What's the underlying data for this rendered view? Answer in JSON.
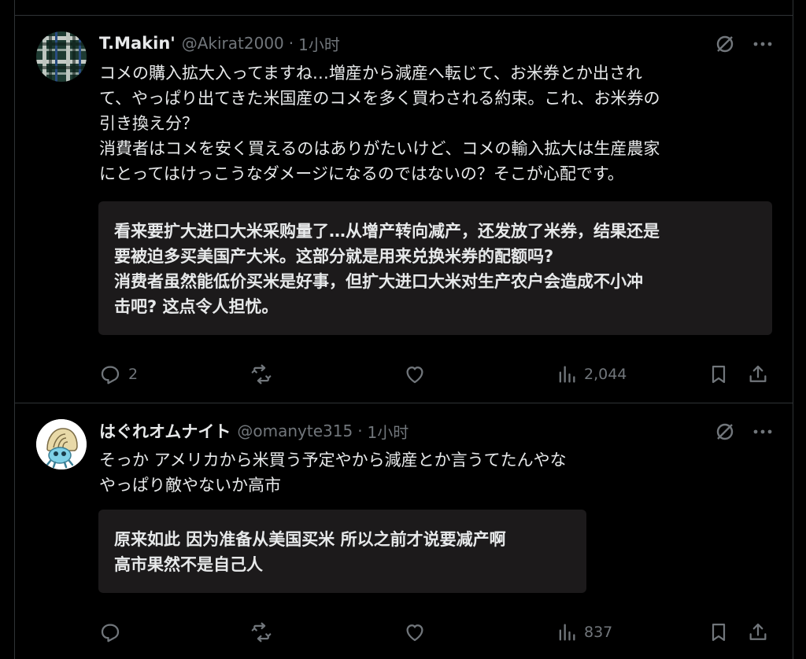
{
  "posts": [
    {
      "author_name": "T.Makin'",
      "handle": "@Akirat2000",
      "separator": "·",
      "time": "1小时",
      "body_lines": [
        "コメの購入拡大入ってますね…増産から減産へ転じて、お米券とか出され",
        "て、やっぱり出てきた米国産のコメを多く買わされる約束。これ、お米券の",
        "引き換え分？",
        "消費者はコメを安く買えるのはありがたいけど、コメの輸入拡大は生産農家",
        "にとってはけっこうなダメージになるのではないの？そこが心配です。"
      ],
      "translation_lines": [
        "看来要扩大进口大米采购量了…从增产转向减产，还发放了米券，结果还是",
        "要被迫多买美国产大米。这部分就是用来兑换米券的配额吗?",
        "消费者虽然能低价买米是好事，但扩大进口大米对生产农户会造成不小冲",
        "击吧? 这点令人担忧。"
      ],
      "reply_count": "2",
      "repost_count": "",
      "like_count": "",
      "view_count": "2,044"
    },
    {
      "author_name": "はぐれオムナイト",
      "handle": "@omanyte315",
      "separator": "·",
      "time": "1小时",
      "body_lines": [
        "そっか アメリカから米買う予定やから減産とか言うてたんやな",
        "やっぱり敵やないか高市"
      ],
      "translation_lines": [
        "原来如此 因为准备从美国买米 所以之前才说要减产啊",
        "高市果然不是自己人"
      ],
      "reply_count": "",
      "repost_count": "",
      "like_count": "",
      "view_count": "837"
    }
  ],
  "icons": {
    "grok": "grok-icon",
    "more": "more-icon",
    "reply": "reply-icon",
    "repost": "repost-icon",
    "like": "like-icon",
    "views": "views-icon",
    "bookmark": "bookmark-icon",
    "share": "share-icon"
  },
  "colors": {
    "background": "#000000",
    "text": "#e7e9ea",
    "muted": "#71767b",
    "divider": "#2f3336",
    "translation_bg": "#1c1a1b"
  }
}
